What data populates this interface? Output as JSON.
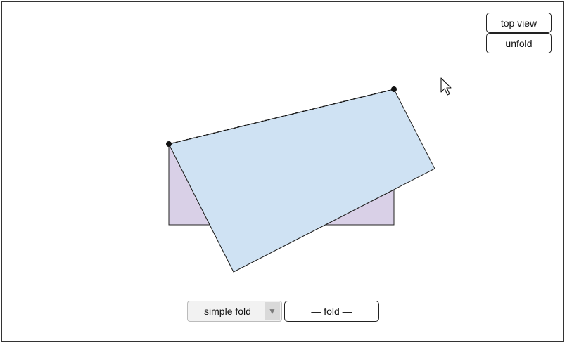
{
  "controls": {
    "top_view_label": "top view",
    "unfold_label": "unfold",
    "fold_type": {
      "selected": "simple fold",
      "arrow_icon": "triangle-down-icon"
    },
    "fold_label": "— fold —"
  },
  "colors": {
    "paper_front": "#cfe2f3",
    "paper_back": "#d9d0e7",
    "outline": "#222222",
    "frame_border": "#333333"
  }
}
